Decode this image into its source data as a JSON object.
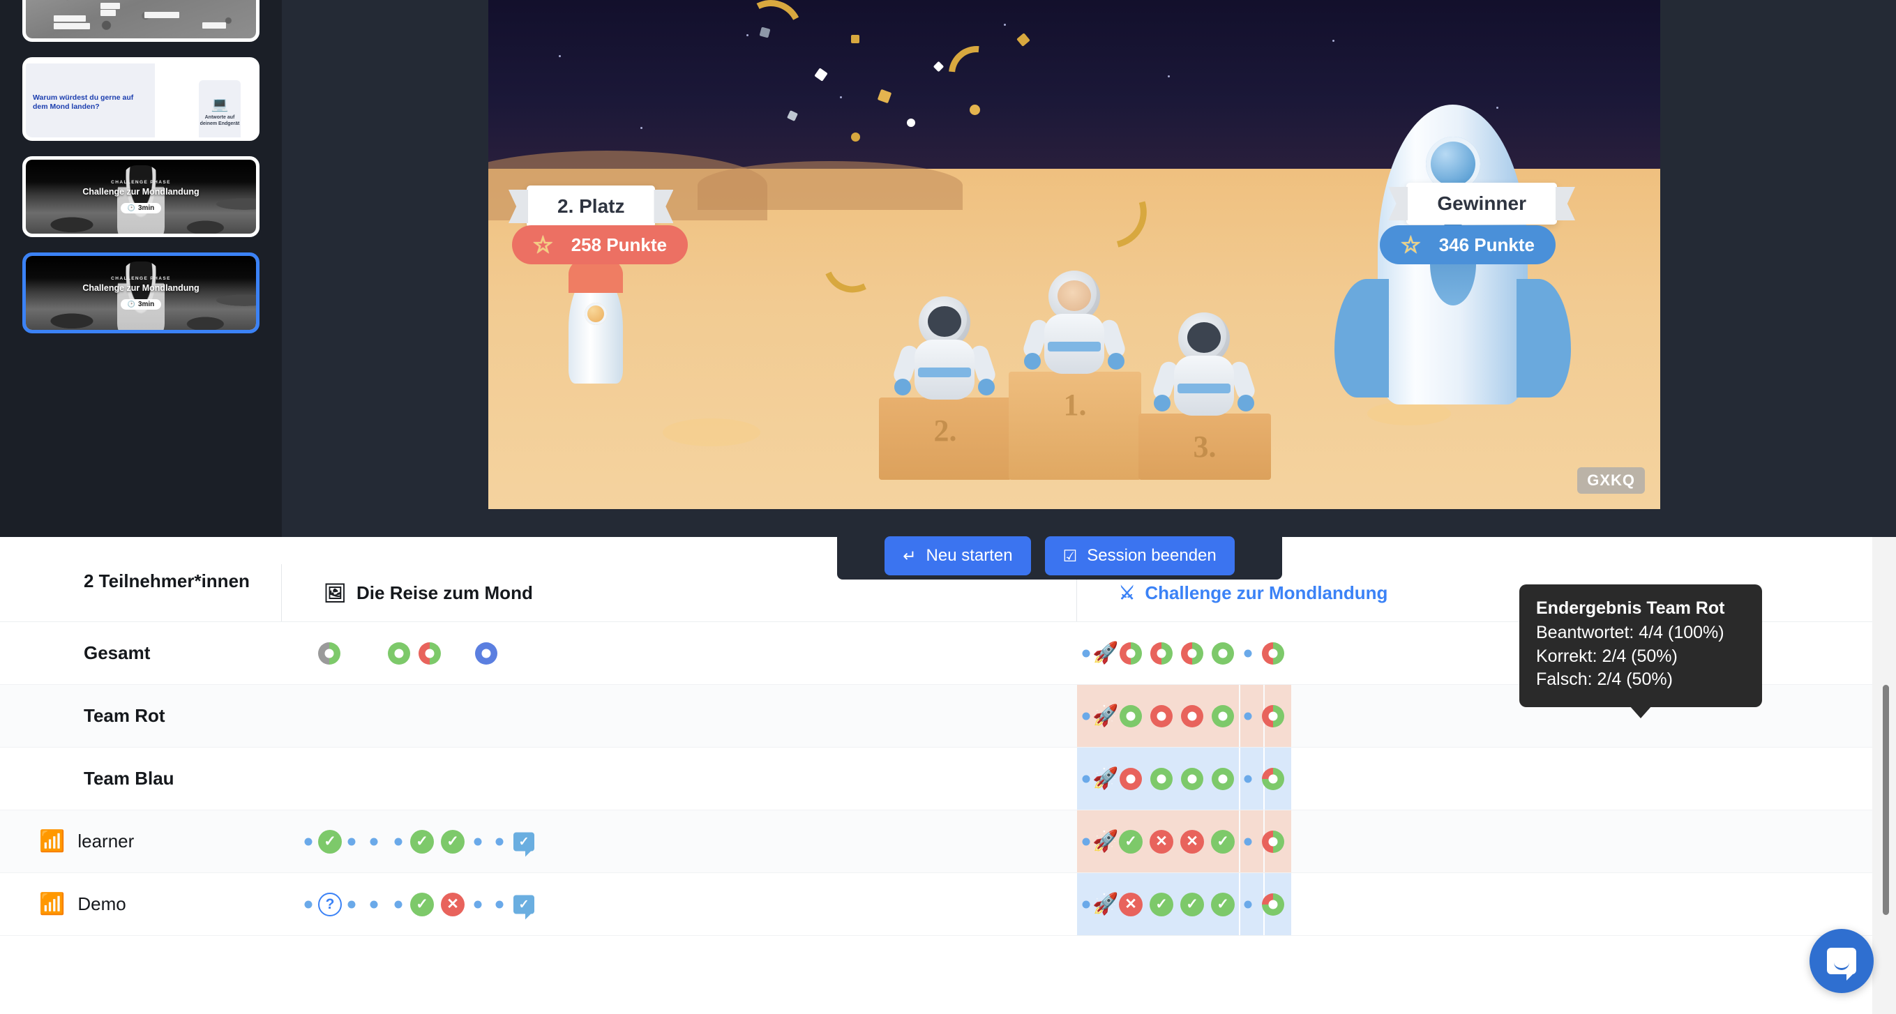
{
  "sidebar": {
    "slides": [
      {
        "type": "moon-map",
        "selected": false
      },
      {
        "type": "question",
        "title": "Warum würdest du gerne auf dem Mond landen?",
        "device_hint": "Antworte auf deinem Endgerät",
        "device_icon": "devices-icon",
        "selected": false
      },
      {
        "type": "challenge",
        "kicker": "CHALLENGE PHASE",
        "title": "Challenge zur Mondlandung",
        "duration": "3min",
        "clock_icon": "clock-icon",
        "selected": false
      },
      {
        "type": "challenge",
        "kicker": "CHALLENGE PHASE",
        "title": "Challenge zur Mondlandung",
        "duration": "3min",
        "clock_icon": "clock-icon",
        "selected": true
      }
    ]
  },
  "stage": {
    "second_place_label": "2. Platz",
    "winner_label": "Gewinner",
    "second_place_points": "258 Punkte",
    "winner_points": "346 Punkte",
    "star_icon": "star-icon",
    "room_code": "GXKQ",
    "podium_numbers": [
      "2.",
      "1.",
      "3."
    ]
  },
  "actions": {
    "restart": {
      "label": "Neu starten",
      "icon": "enter-arrow-icon"
    },
    "end_session": {
      "label": "Session beenden",
      "icon": "checkbox-icon"
    }
  },
  "table": {
    "participants_header": "2 Teilnehmer*innen",
    "groups": [
      {
        "label": "Die Reise zum Mond",
        "icon": "presentation-board-icon",
        "accent": "#15181c"
      },
      {
        "label": "Challenge zur Mondlandung",
        "icon": "crossed-swords-icon",
        "accent": "#3b82f6"
      }
    ],
    "rows": [
      {
        "name": "Gesamt",
        "bold": true,
        "online": false,
        "alt": false
      },
      {
        "name": "Team Rot",
        "bold": true,
        "online": false,
        "alt": true
      },
      {
        "name": "Team Blau",
        "bold": true,
        "online": false,
        "alt": false
      },
      {
        "name": "learner",
        "bold": false,
        "online": true,
        "alt": true,
        "wifi_icon": "wifi-icon"
      },
      {
        "name": "Demo",
        "bold": false,
        "online": true,
        "alt": false,
        "wifi_icon": "wifi-icon"
      }
    ]
  },
  "tooltip": {
    "title": "Endergebnis Team Rot",
    "lines": [
      "Beantwortet: 4/4 (100%)",
      "Korrekt: 2/4 (50%)",
      "Falsch: 2/4 (50%)"
    ]
  },
  "chat_widget": {
    "icon": "intercom-chat-icon"
  },
  "colors": {
    "accent_blue": "#3b82f6",
    "button_blue": "#3b74f0",
    "correct_green": "#7dc96a",
    "wrong_red": "#e8635c",
    "team_red": "#ec7063",
    "team_blue": "#4a90d9",
    "dark_stage": "#242a35",
    "sidebar_dark": "#1b1f27",
    "tooltip_bg": "#2a2a2a"
  }
}
